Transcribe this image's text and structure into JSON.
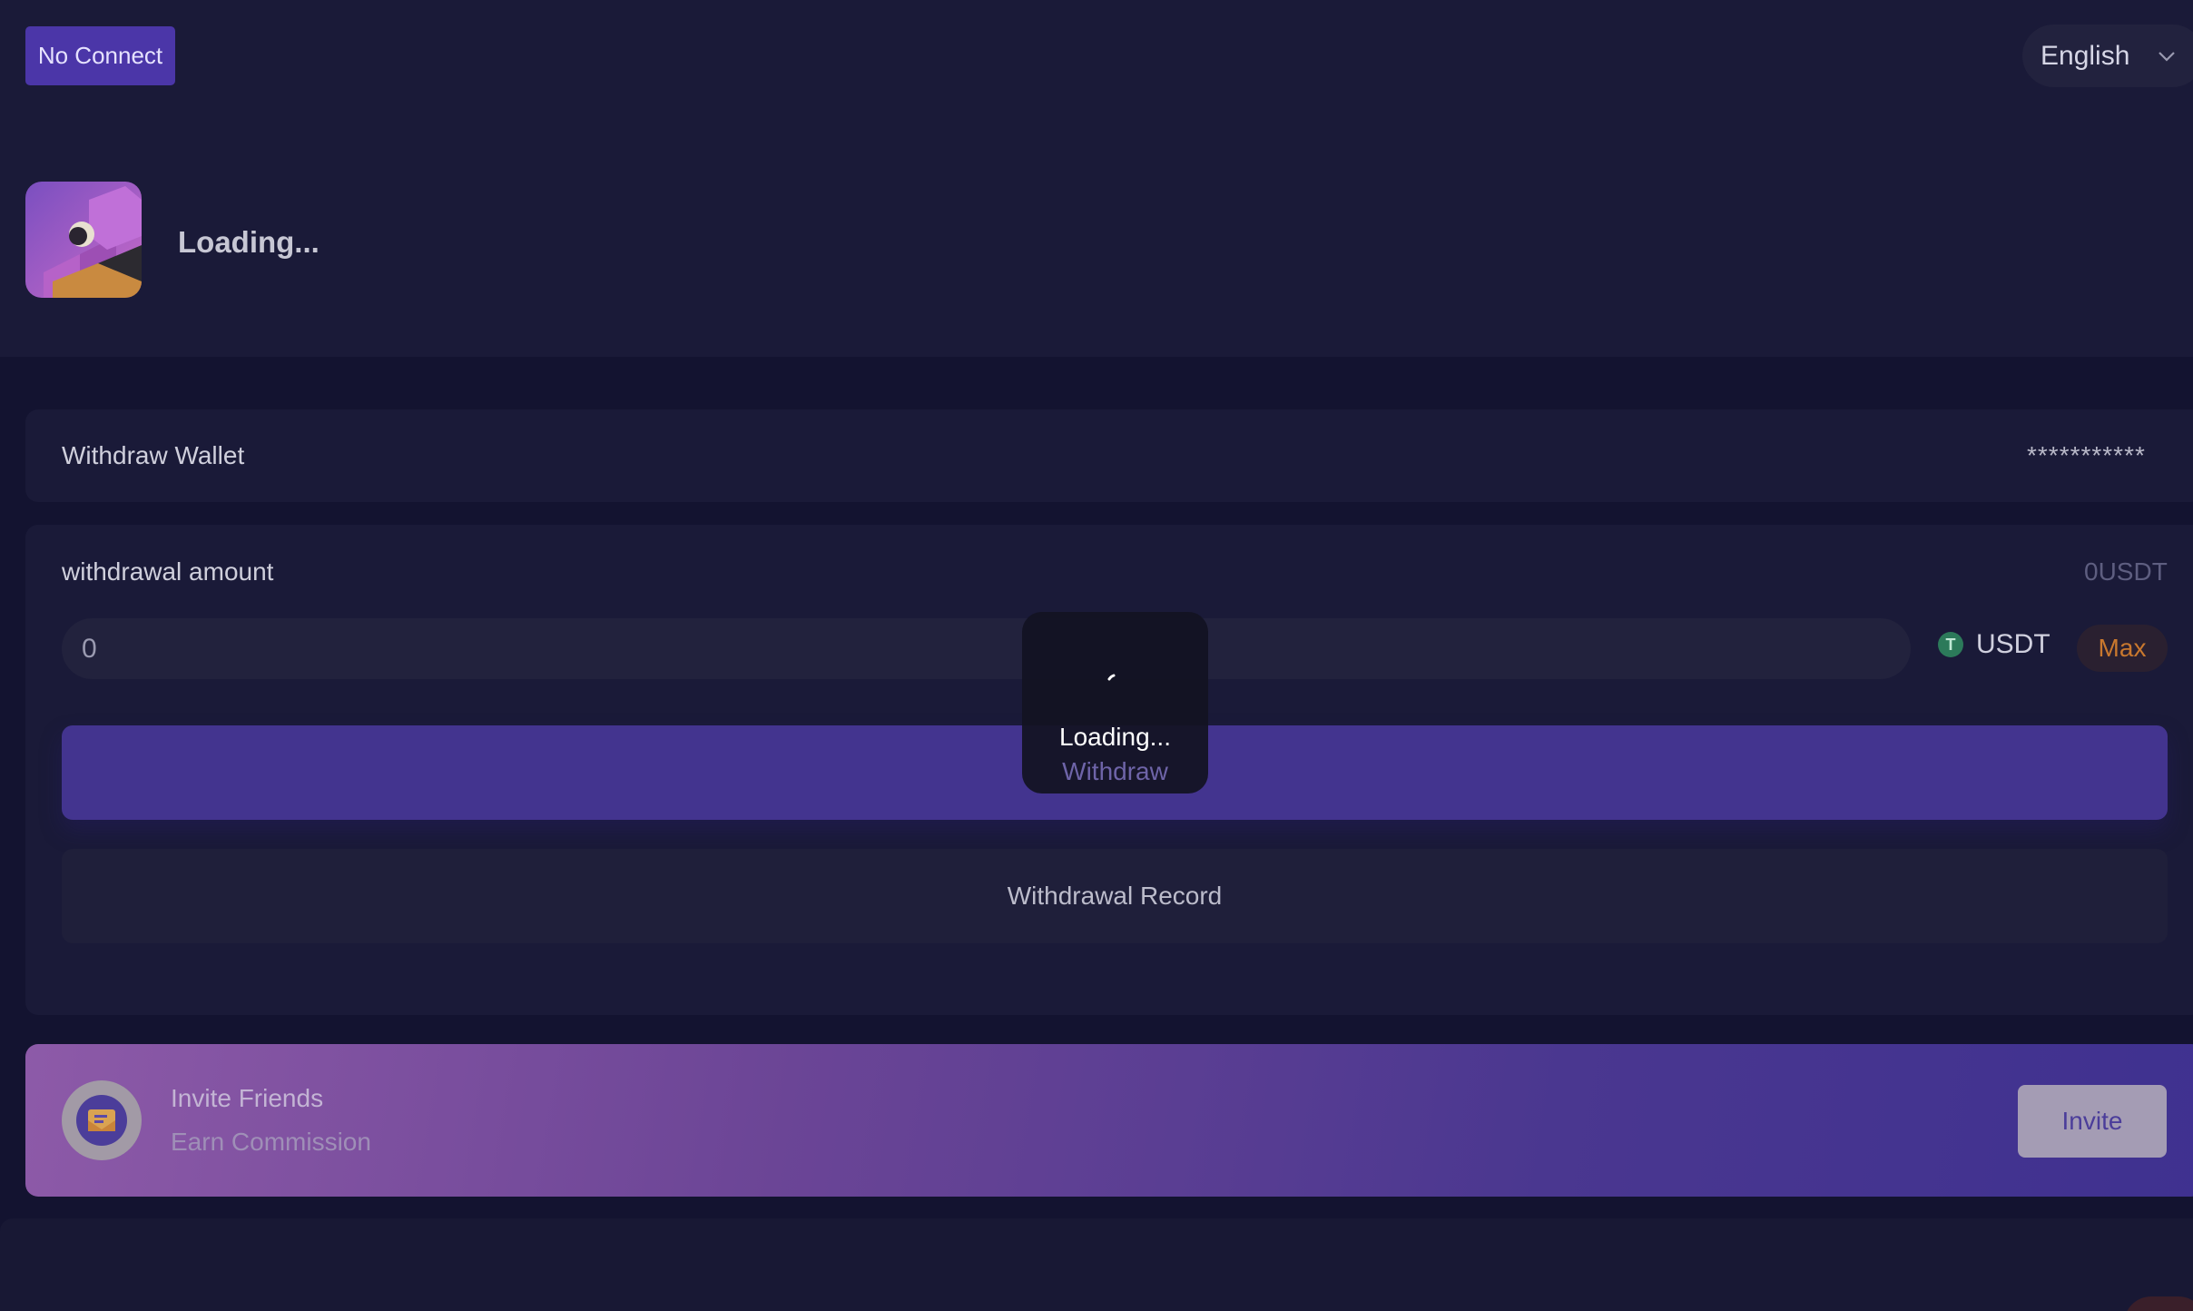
{
  "header": {
    "connect_label": "No Connect",
    "language": "English",
    "app_title": "Loading..."
  },
  "wallet": {
    "label": "Withdraw Wallet",
    "address_masked": "***********"
  },
  "withdraw": {
    "amount_label": "withdrawal amount",
    "balance": "0USDT",
    "amount_value": "0",
    "token_icon_letter": "T",
    "token": "USDT",
    "max_label": "Max",
    "withdraw_label": "Withdraw",
    "record_label": "Withdrawal Record"
  },
  "invite": {
    "title": "Invite Friends",
    "subtitle": "Earn Commission",
    "button_label": "Invite"
  },
  "toast": {
    "text": "Loading..."
  },
  "colors": {
    "background": "#131330",
    "card": "#1a1a38",
    "accent": "#43348f",
    "max": "#c9782e",
    "usdt": "#2c7a5a"
  }
}
